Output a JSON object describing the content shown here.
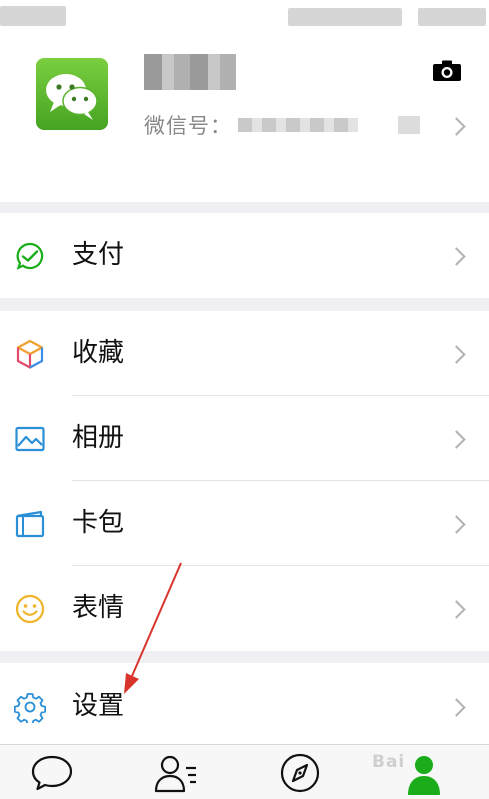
{
  "profile": {
    "wechat_id_label": "微信号："
  },
  "menu": {
    "pay": "支付",
    "favorites": "收藏",
    "album": "相册",
    "card_wallet": "卡包",
    "stickers": "表情",
    "settings": "设置"
  },
  "watermark": "Bai",
  "colors": {
    "brand_green": "#1aad19",
    "annotation_arrow": "#d9342b"
  }
}
